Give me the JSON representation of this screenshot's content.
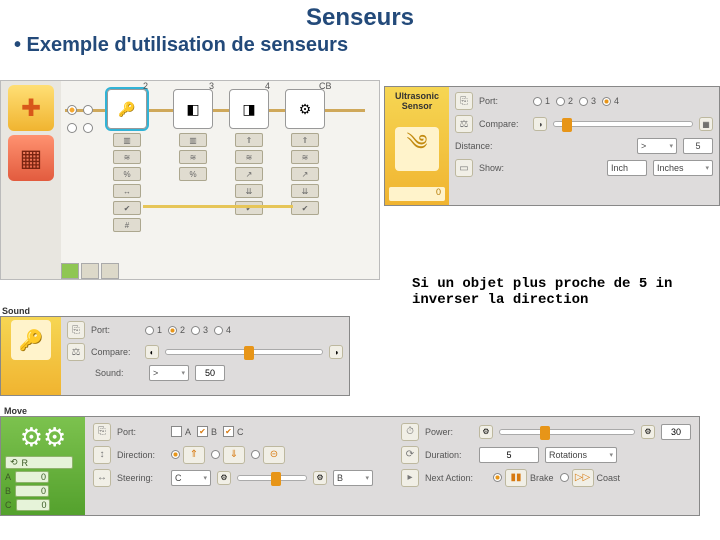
{
  "slide": {
    "title": "Senseurs",
    "subtitle": "• Exemple d'utilisation de senseurs"
  },
  "code_text": "Si un objet plus proche de 5 in\ninverser la direction",
  "palette": {
    "common_icon": "✚",
    "flow_icon": "▦"
  },
  "canvas": {
    "node2_label": "2",
    "node3_label": "3",
    "node4_label": "4",
    "gear_cb_label": "CB"
  },
  "ultrasonic": {
    "title": "Ultrasonic\nSensor",
    "footer_value": "0",
    "port_label": "Port:",
    "ports": [
      "1",
      "2",
      "3",
      "4"
    ],
    "port_selected": "4",
    "compare_label": "Compare:",
    "distance_label": "Distance:",
    "distance_op": ">",
    "distance_value": "5",
    "show_label": "Show:",
    "show_btn": "Inch",
    "show_unit": "Inches"
  },
  "sound": {
    "title": "Sound\nSensor",
    "port_label": "Port:",
    "ports": [
      "1",
      "2",
      "3",
      "4"
    ],
    "port_selected": "2",
    "compare_label": "Compare:",
    "sound_label": "Sound:",
    "sound_op": ">",
    "sound_value": "50"
  },
  "move": {
    "title": "Move",
    "reset": "R",
    "feedback": {
      "a": "A",
      "b": "B",
      "c": "C",
      "a_val": "0",
      "b_val": "0",
      "c_val": "0"
    },
    "port_label": "Port:",
    "ports": {
      "a": "A",
      "b": "B",
      "c": "C"
    },
    "ports_checked": {
      "a": false,
      "b": true,
      "c": true
    },
    "direction_label": "Direction:",
    "steering_label": "Steering:",
    "steering_left": "C",
    "steering_right": "B",
    "power_label": "Power:",
    "power_value": "30",
    "duration_label": "Duration:",
    "duration_value": "5",
    "duration_unit": "Rotations",
    "next_label": "Next Action:",
    "next_brake": "Brake",
    "next_coast": "Coast"
  }
}
